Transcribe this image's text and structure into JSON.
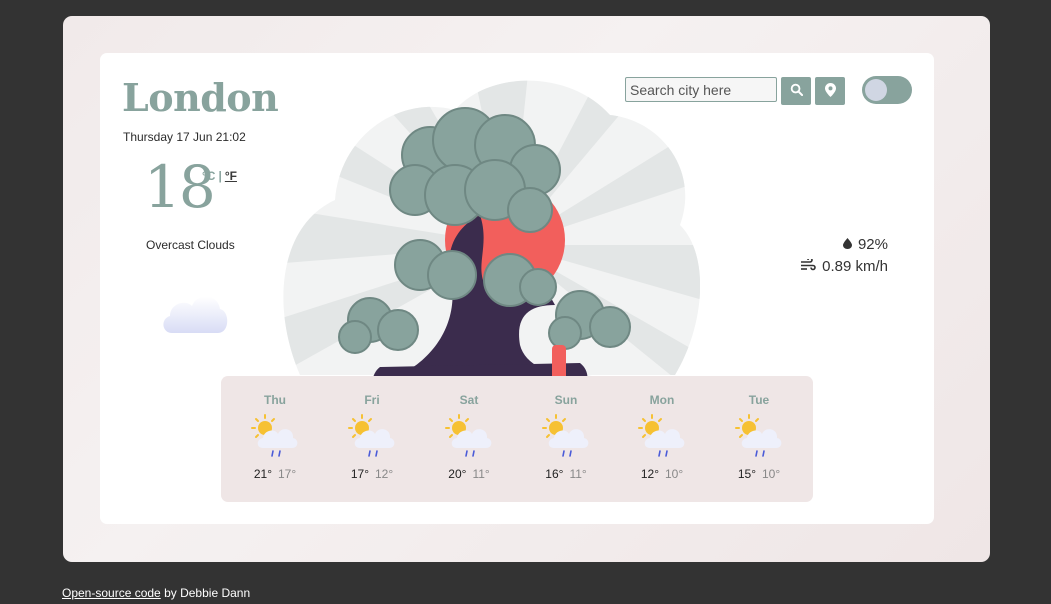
{
  "location": {
    "city": "London",
    "datetime": "Thursday 17 Jun 21:02"
  },
  "current": {
    "temperature": "18",
    "unit_c": "°C",
    "unit_sep": "|",
    "unit_f": "°F",
    "description": "Overcast Clouds",
    "icon": "overcast-cloud-icon"
  },
  "search": {
    "placeholder": "Search city here",
    "value": ""
  },
  "stats": {
    "humidity": "92%",
    "wind": "0.89 km/h"
  },
  "forecast": [
    {
      "day": "Thu",
      "high": "21°",
      "low": "17°",
      "icon": "sun-rain-cloud-icon"
    },
    {
      "day": "Fri",
      "high": "17°",
      "low": "12°",
      "icon": "sun-rain-cloud-icon"
    },
    {
      "day": "Sat",
      "high": "20°",
      "low": "11°",
      "icon": "sun-rain-cloud-icon"
    },
    {
      "day": "Sun",
      "high": "16°",
      "low": "11°",
      "icon": "sun-rain-cloud-icon"
    },
    {
      "day": "Mon",
      "high": "12°",
      "low": "10°",
      "icon": "sun-rain-cloud-icon"
    },
    {
      "day": "Tue",
      "high": "15°",
      "low": "10°",
      "icon": "sun-rain-cloud-icon"
    }
  ],
  "footer": {
    "link_text": "Open-source code",
    "author_text": "by Debbie Dann"
  },
  "colors": {
    "accent": "#88a39d",
    "page_bg": "#333333",
    "sun_red": "#f25f5c",
    "tree_trunk": "#3b2c4d",
    "forecast_bg": "#efe6e6"
  }
}
